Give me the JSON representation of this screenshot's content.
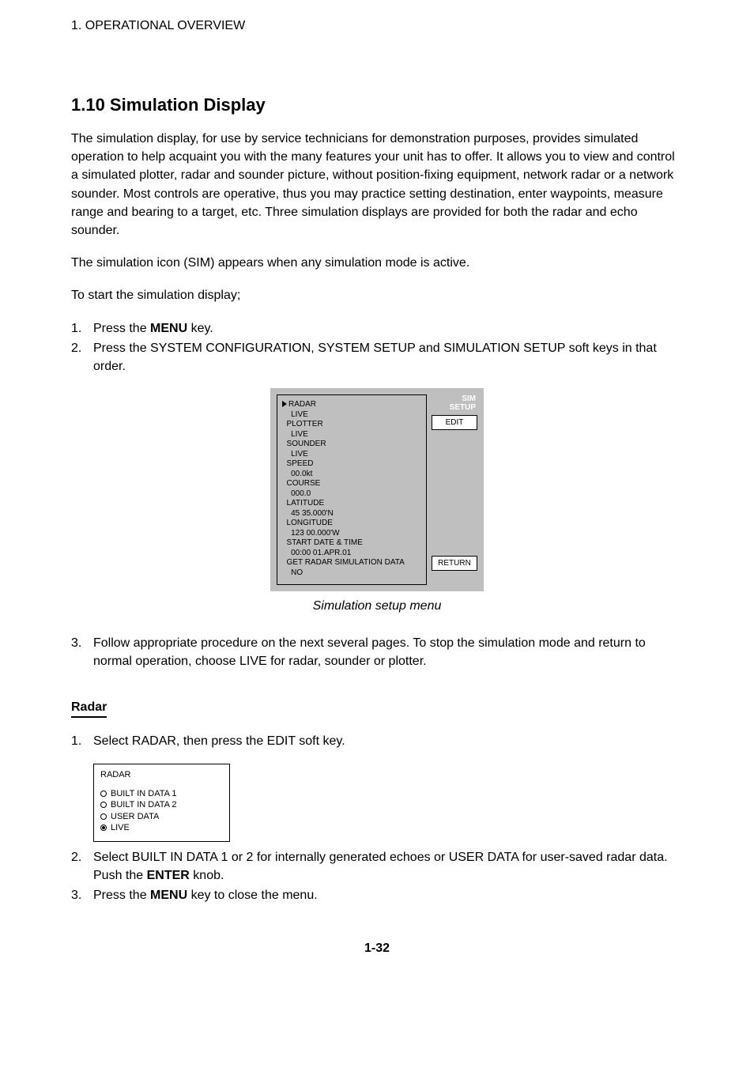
{
  "header": "1. OPERATIONAL OVERVIEW",
  "section_title": "1.10 Simulation Display",
  "para1": "The simulation display, for use by service technicians for demonstration purposes, provides simulated operation to help acquaint you with the many features your unit has to offer. It allows you to view and control a simulated plotter, radar and sounder picture, without position-fixing equipment, network radar or a network sounder. Most controls are operative, thus you may practice setting destination, enter waypoints, measure range and bearing to a target, etc. Three simulation displays are provided for both the radar and echo sounder.",
  "para2": "The simulation icon (SIM) appears when any simulation mode is active.",
  "para3": "To start the simulation display;",
  "steps_a": {
    "s1_a": "Press the ",
    "s1_key": "MENU",
    "s1_b": " key.",
    "s2": "Press the SYSTEM CONFIGURATION, SYSTEM SETUP and SIMULATION SETUP soft keys in that order."
  },
  "sim_panel": {
    "title_line1": "SIM",
    "title_line2": "SETUP",
    "edit_btn": "EDIT",
    "return_btn": "RETURN",
    "rows": [
      "RADAR",
      "    LIVE",
      "  PLOTTER",
      "    LIVE",
      "  SOUNDER",
      "    LIVE",
      "  SPEED",
      "    00.0kt",
      "  COURSE",
      "    000.0",
      "  LATITUDE",
      "    45 35.000'N",
      "  LONGITUDE",
      "    123 00.000'W",
      "  START DATE & TIME",
      "    00:00 01.APR.01",
      "  GET RADAR SIMULATION DATA",
      "    NO"
    ]
  },
  "caption": "Simulation setup menu",
  "steps_b": {
    "s3": "Follow appropriate procedure on the next several pages. To stop the simulation mode and return to normal operation, choose LIVE for radar, sounder or plotter."
  },
  "radar_heading": "Radar",
  "radar_steps": {
    "s1": "Select RADAR, then press the EDIT soft key.",
    "s2_a": "Select BUILT IN DATA 1 or 2 for internally generated echoes or USER DATA for user-saved radar data. Push the ",
    "s2_key": "ENTER",
    "s2_b": " knob.",
    "s3_a": "Press the ",
    "s3_key": "MENU",
    "s3_b": " key to close the menu."
  },
  "radar_box": {
    "title": "RADAR",
    "opt1": "BUILT IN DATA 1",
    "opt2": "BUILT IN DATA 2",
    "opt3": "USER DATA",
    "opt4": "LIVE"
  },
  "page_number": "1-32"
}
